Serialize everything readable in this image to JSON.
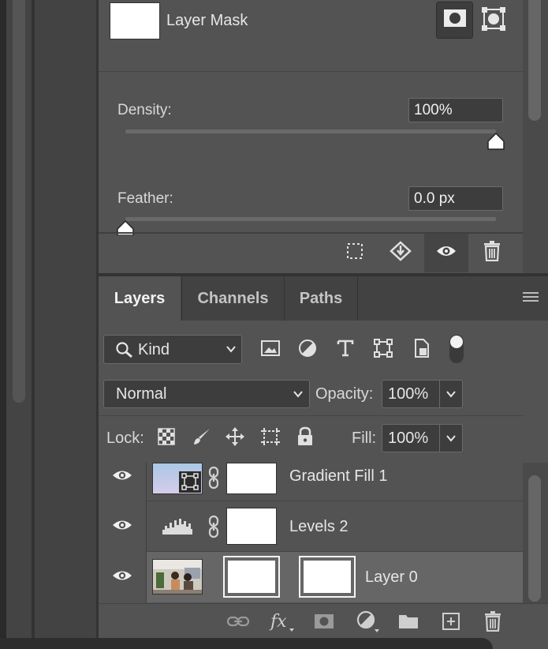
{
  "properties": {
    "mask_type_label": "Layer Mask",
    "density_label": "Density:",
    "density_value": "100%",
    "density_level": 1.0,
    "feather_label": "Feather:",
    "feather_value": "0.0 px",
    "feather_level": 0.0,
    "pixel_mask_icon": "pixel-mask-icon",
    "vector_mask_icon": "vector-mask-icon",
    "footer_icons": [
      "selection-icon",
      "apply-mask-icon",
      "eye-icon",
      "trash-icon"
    ]
  },
  "layers_panel": {
    "tabs": [
      {
        "label": "Layers",
        "active": true
      },
      {
        "label": "Channels",
        "active": false
      },
      {
        "label": "Paths",
        "active": false
      }
    ],
    "filter_kind": "Kind",
    "filter_icons": [
      "image-filter-icon",
      "adjustment-filter-icon",
      "type-filter-icon",
      "shape-filter-icon",
      "smart-object-filter-icon",
      "filter-toggle-icon"
    ],
    "blend_mode": "Normal",
    "opacity_label": "Opacity:",
    "opacity_value": "100%",
    "lock_label": "Lock:",
    "lock_icons": [
      "lock-transparent-icon",
      "lock-paint-icon",
      "lock-position-icon",
      "lock-artboard-icon",
      "lock-all-icon"
    ],
    "fill_label": "Fill:",
    "fill_value": "100%",
    "layers": [
      {
        "name": "Gradient Fill 1",
        "visible": true,
        "selected": false
      },
      {
        "name": "Levels 2",
        "visible": true,
        "selected": false
      },
      {
        "name": "Layer 0",
        "visible": true,
        "selected": true
      }
    ],
    "bottom_icons": [
      "link-icon",
      "fx-icon",
      "add-mask-icon",
      "new-adjustment-icon",
      "new-group-icon",
      "new-layer-icon",
      "delete-icon"
    ]
  },
  "colors": {
    "panel": "#535353",
    "selected_row": "#666666",
    "field": "#3d3d3d"
  }
}
